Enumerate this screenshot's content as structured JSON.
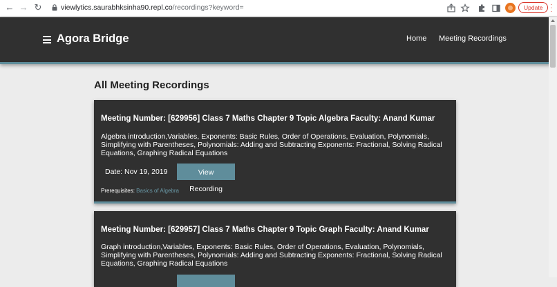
{
  "browser": {
    "url_host": "viewlytics.saurabhksinha90.repl.co",
    "url_path": "/recordings?keyword=",
    "update_label": "Update"
  },
  "header": {
    "brand": "Agora Bridge",
    "nav": [
      "Home",
      "Meeting Recordings"
    ]
  },
  "page": {
    "title": "All Meeting Recordings"
  },
  "recordings": [
    {
      "title": "Meeting Number: [629956] Class 7 Maths Chapter 9 Topic Algebra Faculty: Anand Kumar",
      "description": "Algebra introduction,Variables, Exponents: Basic Rules, Order of Operations, Evaluation, Polynomials, Simplifying with Parentheses, Polynomials: Adding and Subtracting Exponents: Fractional, Solving Radical Equations, Graphing Radical Equations",
      "date": "Date: Nov 19, 2019",
      "button": "View Recording",
      "prereq_label": "Prerequisites:",
      "prereq_link": "Basics of Algebra"
    },
    {
      "title": "Meeting Number: [629957] Class 7 Maths Chapter 9 Topic Graph Faculty: Anand Kumar",
      "description": "Graph introduction,Variables, Exponents: Basic Rules, Order of Operations, Evaluation, Polynomials, Simplifying with Parentheses, Polynomials: Adding and Subtracting Exponents: Fractional, Solving Radical Equations, Graphing Radical Equations"
    }
  ]
}
